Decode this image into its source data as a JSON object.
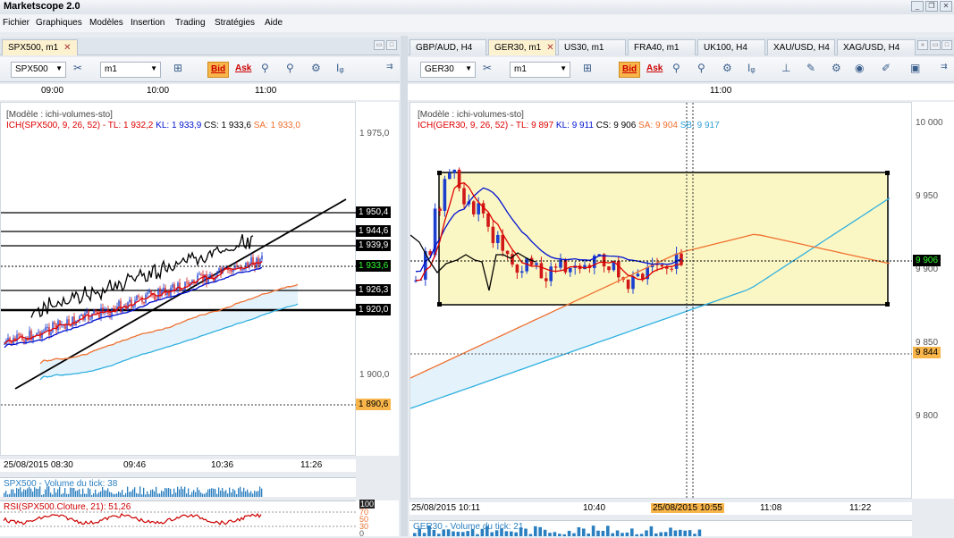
{
  "app": {
    "title": "Marketscope 2.0"
  },
  "menu": [
    "Fichier",
    "Graphiques",
    "Modèles",
    "Insertion",
    "Trading",
    "Stratégies",
    "Aide"
  ],
  "left_panel": {
    "tab": "SPX500, m1",
    "symbol": "SPX500",
    "timeframe": "m1",
    "bid_label": "Bid",
    "ask_label": "Ask",
    "time_axis": [
      "09:00",
      "10:00",
      "11:00"
    ],
    "legend_model": "[Modèle : ichi-volumes-sto]",
    "legend_ich": "ICH(SPX500, 9, 26, 52) -",
    "tl": "TL: 1 932,2",
    "kl": "KL: 1 933,9",
    "cs": "CS: 1 933,6",
    "sa": "SA: 1 933,0",
    "price_axis": [
      "1 975,0",
      "1 900,0"
    ],
    "price_labels": [
      {
        "text": "1 950,4",
        "style": "black"
      },
      {
        "text": "1 944,6",
        "style": "black"
      },
      {
        "text": "1 939,9",
        "style": "black"
      },
      {
        "text": "1 933,6",
        "style": "green"
      },
      {
        "text": "1 926,3",
        "style": "black"
      },
      {
        "text": "1 920,0",
        "style": "black"
      },
      {
        "text": "1 890,6",
        "style": "orange"
      }
    ],
    "date_axis": [
      "25/08/2015 08:30",
      "09:46",
      "10:36",
      "11:26"
    ],
    "volume_label": "SPX500 - Volume du tick: 38",
    "rsi_label": "RSI(SPX500.Cloture, 21): 51,26",
    "rsi_axis": [
      "100",
      "70",
      "50",
      "30",
      "0"
    ]
  },
  "right_panel": {
    "tabs": [
      "GBP/AUD, H4",
      "GER30, m1",
      "US30, m1",
      "FRA40, m1",
      "UK100, H4",
      "XAU/USD, H4",
      "XAG/USD, H4"
    ],
    "active_tab": 1,
    "symbol": "GER30",
    "timeframe": "m1",
    "bid_label": "Bid",
    "ask_label": "Ask",
    "time_axis": [
      "11:00"
    ],
    "legend_model": "[Modèle : ichi-volumes-sto]",
    "legend_ich": "ICH(GER30, 9, 26, 52) -",
    "tl": "TL: 9 897",
    "kl": "KL: 9 911",
    "cs": "CS: 9 906",
    "sa": "SA: 9 904",
    "sb": "SB: 9 917",
    "price_axis": [
      "10 000",
      "9 950",
      "9 900",
      "9 850",
      "9 800"
    ],
    "price_labels": [
      {
        "text": "9 906",
        "style": "green"
      },
      {
        "text": "9 844",
        "style": "orange"
      }
    ],
    "date_axis": [
      "25/08/2015 10:11",
      "10:40",
      "25/08/2015 10:55",
      "11:08",
      "11:22"
    ],
    "volume_label": "GER30 - Volume du tick: 21"
  },
  "colors": {
    "bid_bg": "#f7b54a",
    "tenkan": "#e00000",
    "kijun": "#0010d0",
    "senkou_a": "#f07030",
    "senkou_b": "#30b0e0",
    "chikou": "#000000",
    "selection_fill": "#fbf7c4"
  }
}
